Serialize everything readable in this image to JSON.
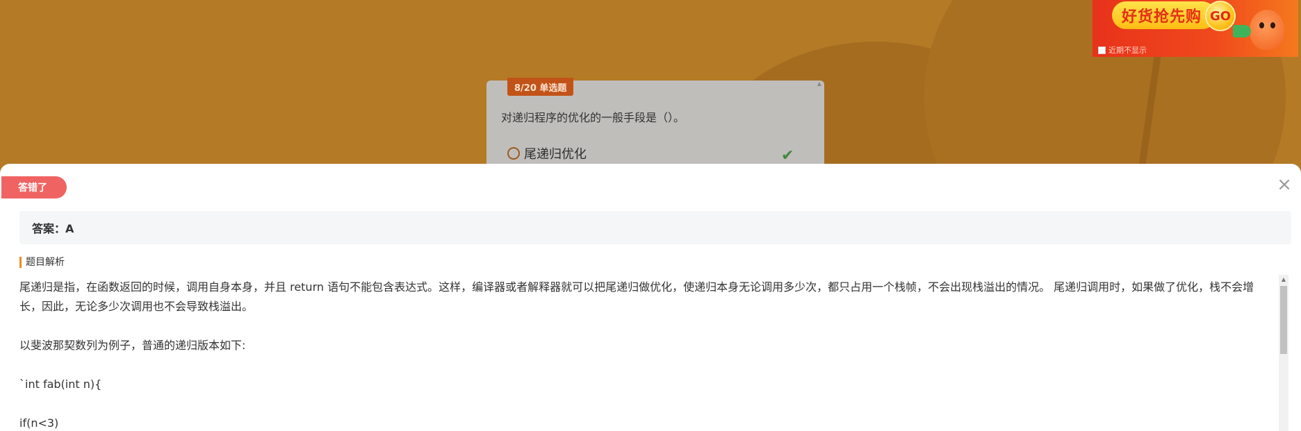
{
  "ad": {
    "headline": "好货抢先购",
    "go_label": "GO",
    "dont_show_label": "近期不显示"
  },
  "question": {
    "tag": "8/20 单选题",
    "text": "对递归程序的优化的一般手段是（）。",
    "options": [
      {
        "label": "尾递归优化",
        "correct": true
      }
    ]
  },
  "result": {
    "badge": "答错了",
    "answer": "答案：A",
    "analysis_title": "题目解析",
    "analysis_lines": [
      "尾递归是指，在函数返回的时候，调用自身本身，并且 return 语句不能包含表达式。这样，编译器或者解释器就可以把尾递归做优化，使递归本身无论调用多少次，都只占用一个栈帧，不会出现栈溢出的情况。 尾递归调用时，如果做了优化，栈不会增长，因此，无论多少次调用也不会导致栈溢出。",
      "",
      "以斐波那契数列为例子，普通的递归版本如下:",
      "",
      "`int fab(int n){",
      "",
      "if(n<3)"
    ]
  },
  "colors": {
    "background": "#b47a25",
    "badge_wrong": "#f06363",
    "tag": "#c25318",
    "accent_bar": "#f08a1e",
    "correct_check": "#3e8a3e"
  }
}
